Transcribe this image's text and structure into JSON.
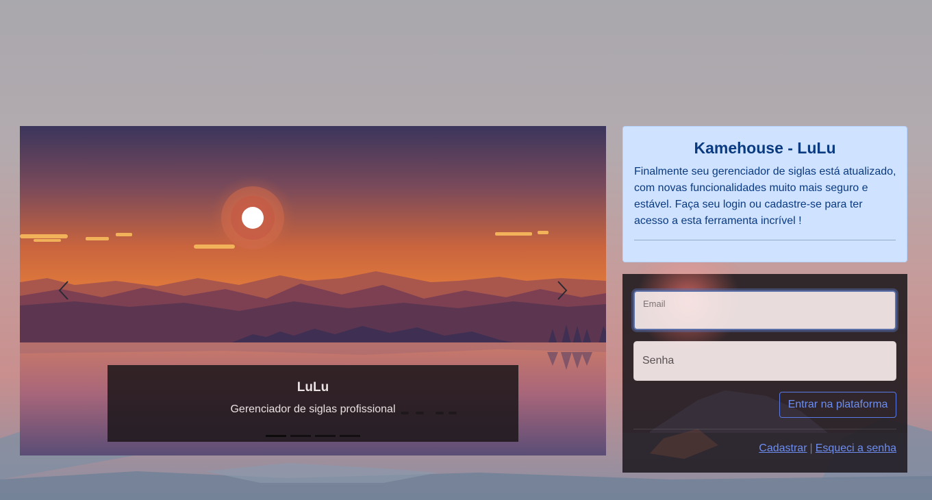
{
  "carousel": {
    "slides_count": 4,
    "active_slide": 1,
    "caption_title": "LuLu",
    "caption_subtitle": "Gerenciador de siglas profissional",
    "prev_icon": "chevron-left-icon",
    "next_icon": "chevron-right-icon"
  },
  "info": {
    "title": "Kamehouse - LuLu",
    "text": "Finalmente seu gerenciador de siglas está atualizado, com novas funcionalidades muito mais seguro e estável. Faça seu login ou cadastre-se para ter acesso a esta ferramenta incrível !"
  },
  "login": {
    "email_label": "Email",
    "email_value": "",
    "senha_label": "Senha",
    "senha_value": "",
    "submit_label": "Entrar na plataforma",
    "register_link": "Cadastrar",
    "separator": "|",
    "forgot_link": "Esqueci a senha"
  },
  "colors": {
    "info_bg": "#cfe2ff",
    "info_text": "#0a3a80",
    "link": "#6d8ef0",
    "panel_bg": "#1c181c"
  }
}
